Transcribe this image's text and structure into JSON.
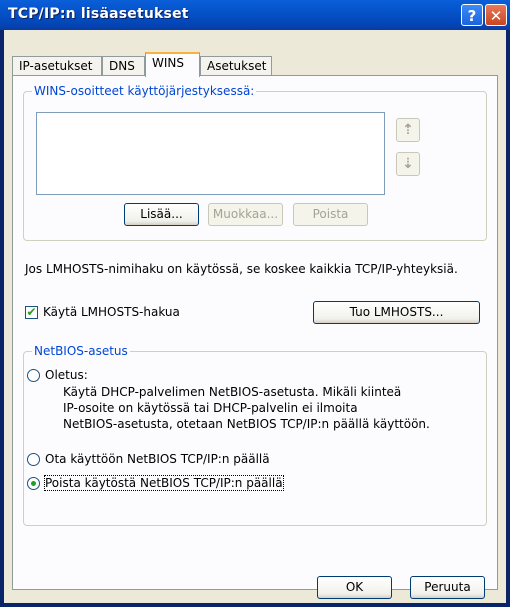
{
  "window": {
    "title": "TCP/IP:n lisäasetukset",
    "help_glyph": "?",
    "close_glyph": "✕"
  },
  "tabs": [
    {
      "label": "IP-asetukset",
      "active": false
    },
    {
      "label": "DNS",
      "active": false
    },
    {
      "label": "WINS",
      "active": true
    },
    {
      "label": "Asetukset",
      "active": false
    }
  ],
  "wins_group": {
    "legend": "WINS-osoitteet käyttöjärjestyksessä:",
    "up_glyph": "⇡",
    "down_glyph": "⇣",
    "add_label": "Lisää...",
    "edit_label": "Muokkaa...",
    "remove_label": "Poista"
  },
  "lmhosts_info": "Jos LMHOSTS-nimihaku on käytössä, se koskee kaikkia TCP/IP-yhteyksiä.",
  "lmhosts_checkbox": {
    "label": "Käytä LMHOSTS-hakua",
    "checked": true,
    "check_glyph": "✔"
  },
  "import_button": "Tuo LMHOSTS...",
  "netbios": {
    "legend": "NetBIOS-asetus",
    "default_label": "Oletus:",
    "default_desc": [
      "Käytä DHCP-palvelimen NetBIOS-asetusta. Mikäli kiinteä",
      "IP-osoite on käytössä tai DHCP-palvelin ei ilmoita",
      "NetBIOS-asetusta, otetaan NetBIOS TCP/IP:n päällä käyttöön."
    ],
    "enable_label": "Ota käyttöön NetBIOS TCP/IP:n päällä",
    "disable_label": "Poista käytöstä NetBIOS TCP/IP:n päällä",
    "selected": "disable"
  },
  "footer": {
    "ok_label": "OK",
    "cancel_label": "Peruuta"
  },
  "colors": {
    "title_blue": "#0552c9",
    "legend_blue": "#0046d5",
    "window_bg": "#ece9d8"
  }
}
